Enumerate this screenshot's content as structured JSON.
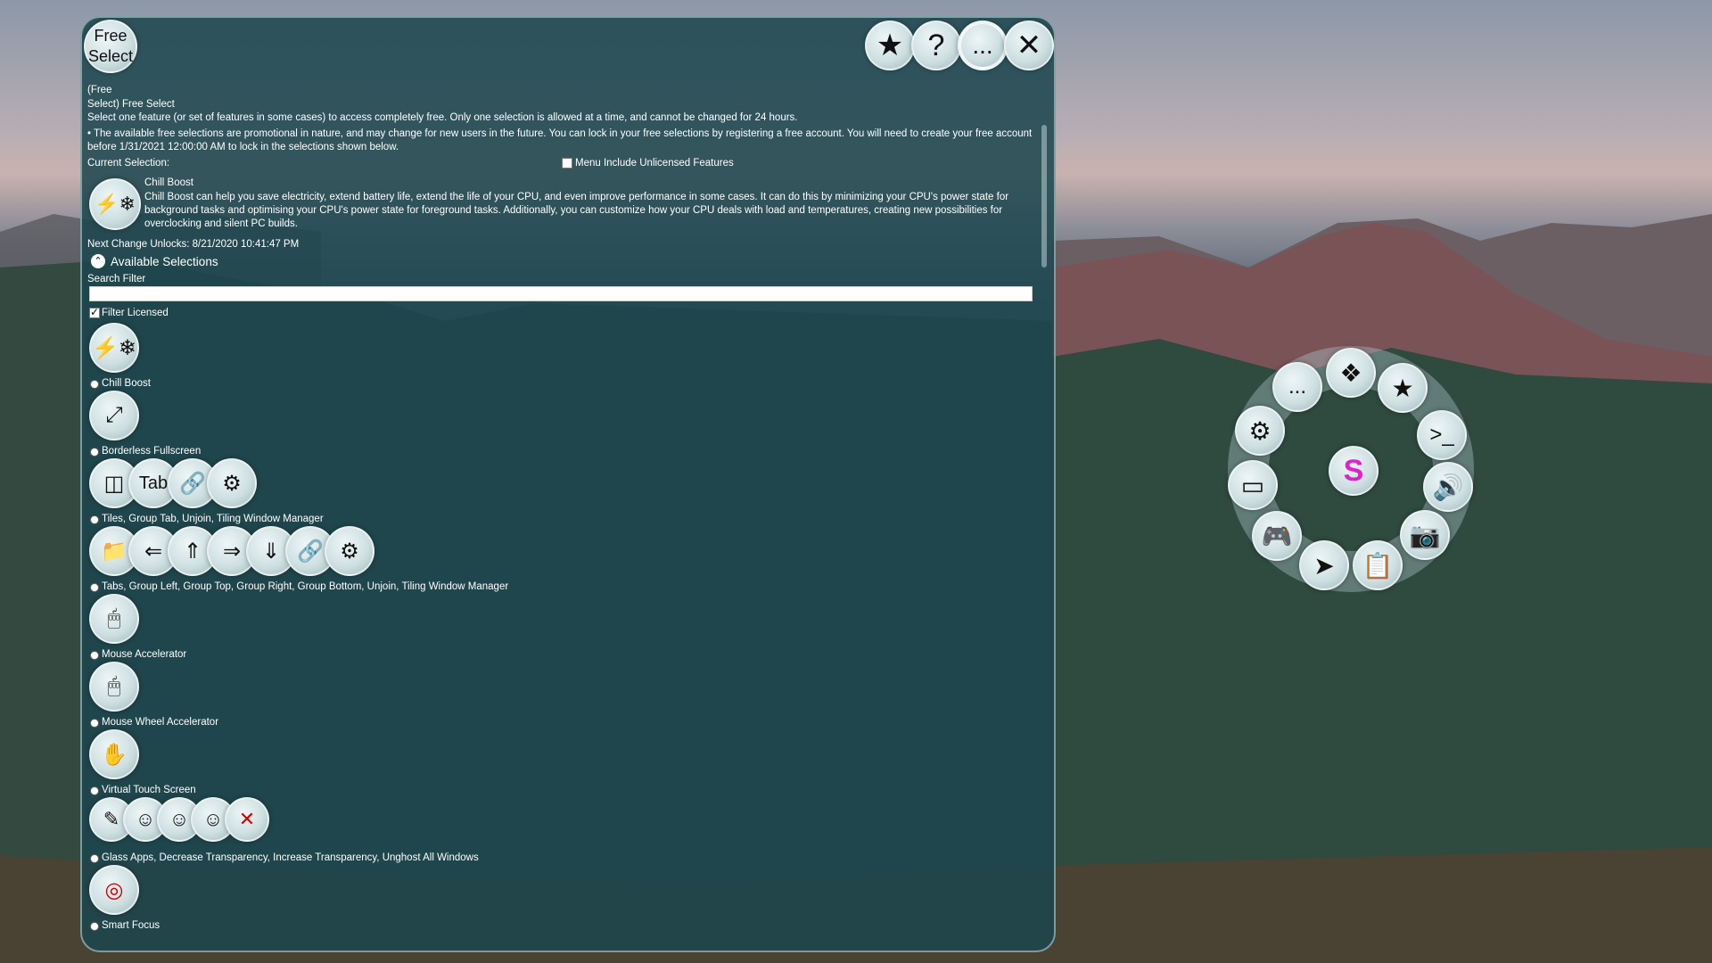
{
  "window": {
    "title_line1": "Free",
    "title_line2": "Select",
    "buttons": [
      {
        "name": "favorite",
        "glyph": "★"
      },
      {
        "name": "help",
        "glyph": "?"
      },
      {
        "name": "more",
        "glyph": "..."
      },
      {
        "name": "close",
        "glyph": "✕"
      }
    ]
  },
  "header": {
    "crumb_a": "(Free",
    "crumb_b": "Select)  Free Select",
    "desc": "Select one feature (or set of features in some cases) to access completely free.  Only one selection is allowed at a time, and cannot be changed for 24 hours.",
    "note": "• The available free selections are promotional in nature, and may change for new users in the future.  You can lock in your free selections by registering a free account.  You will need to create your free account before 1/31/2021 12:00:00 AM to lock in the selections shown below.",
    "current_label": "Current Selection:",
    "menu_include_label": "Menu Include Unlicensed Features"
  },
  "current": {
    "name": "Chill Boost",
    "desc": "Chill Boost can help you save electricity, extend battery life, extend the life of your CPU, and even improve performance in some cases.  It can do this by minimizing your CPU's power state for background tasks and optimising your CPU's power state for foreground tasks.  Additionally, you can customize how your CPU deals with load and temperatures, creating new possibilities for overclocking and silent PC builds.",
    "next_change": "Next Change Unlocks: 8/21/2020 10:41:47 PM"
  },
  "available": {
    "heading": "Available Selections",
    "search_label": "Search Filter",
    "search_value": "",
    "filter_licensed_label": "Filter Licensed",
    "filter_licensed": true
  },
  "features": [
    {
      "label": "Chill Boost",
      "icons": [
        "⚡❄"
      ]
    },
    {
      "label": "Borderless Fullscreen",
      "icons": [
        "⤢"
      ]
    },
    {
      "label": "Tiles, Group Tab, Unjoin, Tiling Window Manager",
      "icons": [
        "◫",
        "Tab",
        "🔗",
        "⚙"
      ]
    },
    {
      "label": "Tabs, Group Left, Group Top, Group Right, Group Bottom, Unjoin, Tiling Window Manager",
      "icons": [
        "📁",
        "⇐",
        "⇑",
        "⇒",
        "⇓",
        "🔗",
        "⚙"
      ]
    },
    {
      "label": "Mouse Accelerator",
      "icons": [
        "🖱"
      ]
    },
    {
      "label": "Mouse Wheel Accelerator",
      "icons": [
        "🖱"
      ]
    },
    {
      "label": "Virtual Touch Screen",
      "icons": [
        "✋"
      ]
    },
    {
      "label": "Glass Apps, Decrease Transparency, Increase Transparency, Unghost All Windows",
      "icons": [
        "✎",
        "☺",
        "☺",
        "☺",
        "✕"
      ]
    },
    {
      "label": "Smart Focus",
      "icons": [
        "◎"
      ]
    }
  ],
  "radial_menu": {
    "items": [
      {
        "name": "more",
        "glyph": "..."
      },
      {
        "name": "apps",
        "glyph": "❖"
      },
      {
        "name": "favorites",
        "glyph": "★"
      },
      {
        "name": "terminal",
        "glyph": ">_"
      },
      {
        "name": "volume",
        "glyph": "🔊"
      },
      {
        "name": "screenshot",
        "glyph": "📷"
      },
      {
        "name": "clipboard",
        "glyph": "📋"
      },
      {
        "name": "send",
        "glyph": "➤"
      },
      {
        "name": "gamepad",
        "glyph": "🎮"
      },
      {
        "name": "window",
        "glyph": "▭"
      },
      {
        "name": "settings",
        "glyph": "⚙"
      }
    ],
    "center_logo": "S"
  }
}
